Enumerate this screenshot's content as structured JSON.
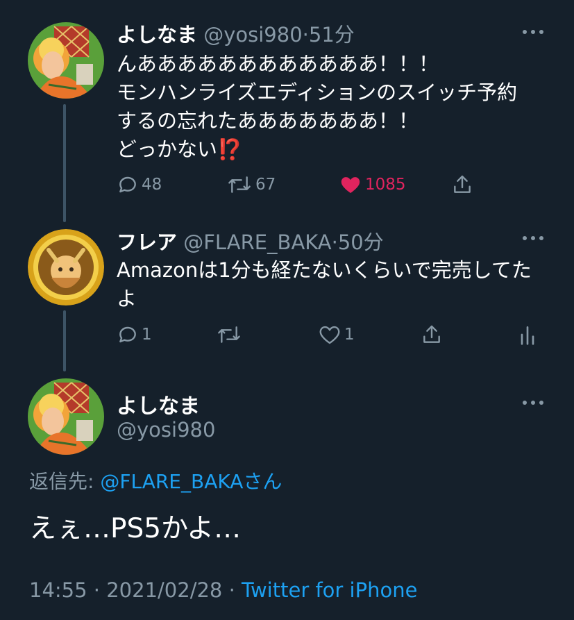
{
  "tweets": [
    {
      "name": "よしなま",
      "handle": "@yosi980",
      "separator": "·",
      "time": "51分",
      "text": "んああああああああああああ！！！\nモンハンライズエディションのスイッチ予約\nするの忘れたあああああああ！！\nどっかない⁉️",
      "replies": "48",
      "retweets": "67",
      "likes": "1085",
      "liked": true
    },
    {
      "name": "フレア",
      "handle": "@FLARE_BAKA",
      "separator": "·",
      "time": "50分",
      "text": "Amazonは1分も経たないくらいで完売してた\nよ",
      "replies": "1",
      "retweets": "",
      "likes": "1",
      "liked": false
    }
  ],
  "main_tweet": {
    "name": "よしなま",
    "handle": "@yosi980",
    "reply_to_label": "返信先: ",
    "reply_to_mention": "@FLARE_BAKAさん",
    "text": "えぇ…PS5かよ…",
    "time": "14:55",
    "separator": "·",
    "date": "2021/02/28",
    "separator2": "·",
    "source": "Twitter for iPhone"
  },
  "icons": {
    "reply": "reply-icon",
    "retweet": "retweet-icon",
    "like": "heart-icon",
    "share": "share-icon",
    "analytics": "analytics-icon",
    "more": "more-icon"
  },
  "colors": {
    "background": "#15202b",
    "secondary_text": "#8899a6",
    "link": "#1da1f2",
    "like": "#e0245e"
  }
}
